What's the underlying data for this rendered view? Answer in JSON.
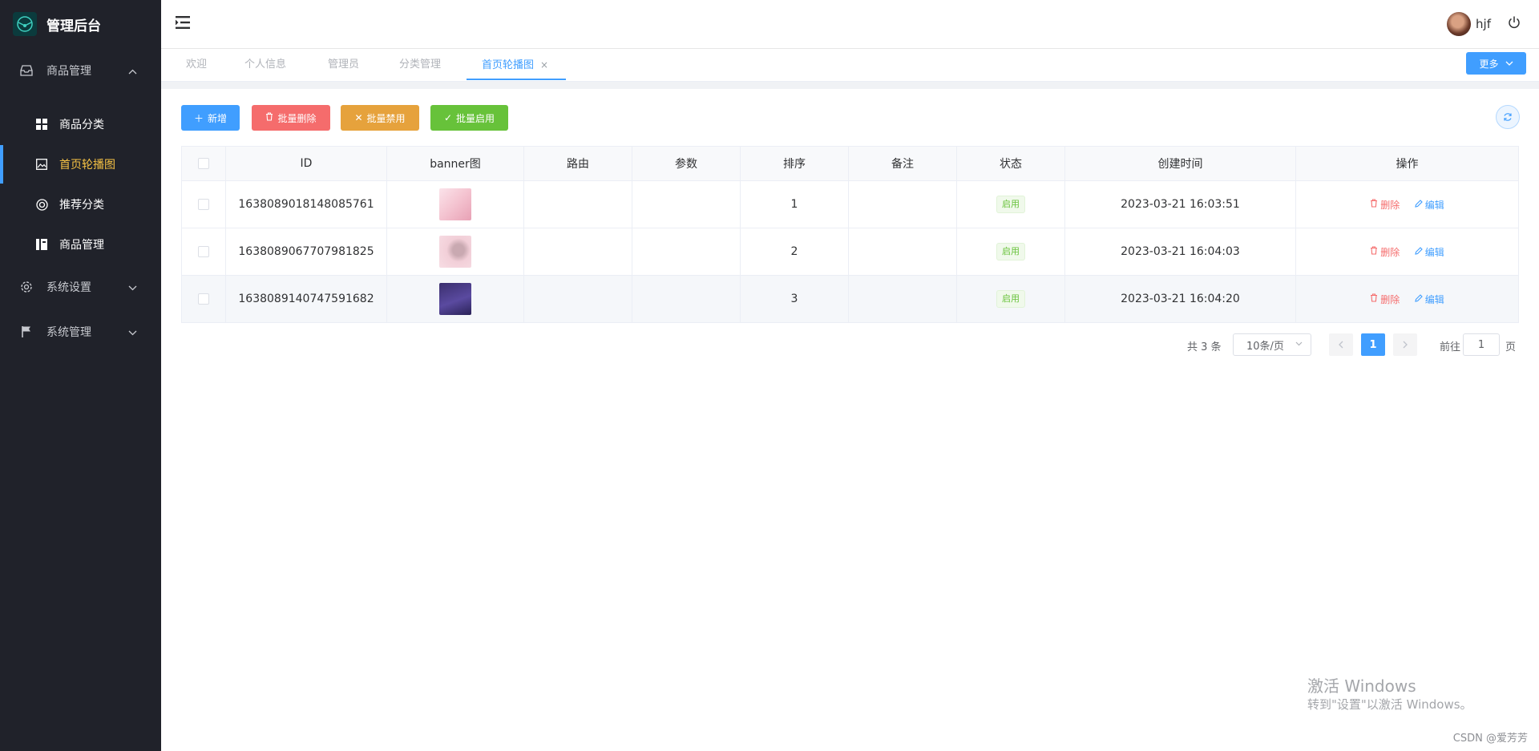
{
  "app": {
    "title": "管理后台"
  },
  "sidebar": {
    "groups": [
      {
        "label": "商品管理",
        "icon": "inbox-icon"
      },
      {
        "label": "系统设置",
        "icon": "gear-icon"
      },
      {
        "label": "系统管理",
        "icon": "flag-icon"
      }
    ],
    "items": [
      {
        "label": "商品分类",
        "icon": "grid-icon"
      },
      {
        "label": "首页轮播图",
        "icon": "image-icon"
      },
      {
        "label": "推荐分类",
        "icon": "lifebuoy-icon"
      },
      {
        "label": "商品管理",
        "icon": "box-icon"
      }
    ],
    "active_color": "#f6c244"
  },
  "header": {
    "username": "hjf"
  },
  "tabs": {
    "items": [
      "欢迎",
      "个人信息",
      "管理员",
      "分类管理",
      "首页轮播图"
    ],
    "close_glyph": "×",
    "more_label": "更多"
  },
  "toolbar": {
    "add_label": "新增",
    "batch_delete_label": "批量删除",
    "batch_disable_label": "批量禁用",
    "batch_enable_label": "批量启用",
    "colors": {
      "add": "#409eff",
      "delete": "#f56c6c",
      "disable": "#e6a23c",
      "enable": "#67c23a"
    }
  },
  "table": {
    "columns": [
      "ID",
      "banner图",
      "路由",
      "参数",
      "排序",
      "备注",
      "状态",
      "创建时间",
      "操作"
    ],
    "rows": [
      {
        "id": "1638089018148085761",
        "route": "",
        "params": "",
        "sort": "1",
        "remark": "",
        "status": "启用",
        "created": "2023-03-21 16:03:51"
      },
      {
        "id": "1638089067707981825",
        "route": "",
        "params": "",
        "sort": "2",
        "remark": "",
        "status": "启用",
        "created": "2023-03-21 16:04:03"
      },
      {
        "id": "1638089140747591682",
        "route": "",
        "params": "",
        "sort": "3",
        "remark": "",
        "status": "启用",
        "created": "2023-03-21 16:04:20"
      }
    ],
    "delete_label": "删除",
    "edit_label": "编辑"
  },
  "pagination": {
    "total_text": "共 3 条",
    "page_size": "10条/页",
    "current_page": "1",
    "goto_label": "前往",
    "goto_value": "1",
    "goto_suffix": "页"
  },
  "watermark": {
    "line1": "激活 Windows",
    "line2": "转到\"设置\"以激活 Windows。"
  },
  "credit": "CSDN @爱芳芳"
}
